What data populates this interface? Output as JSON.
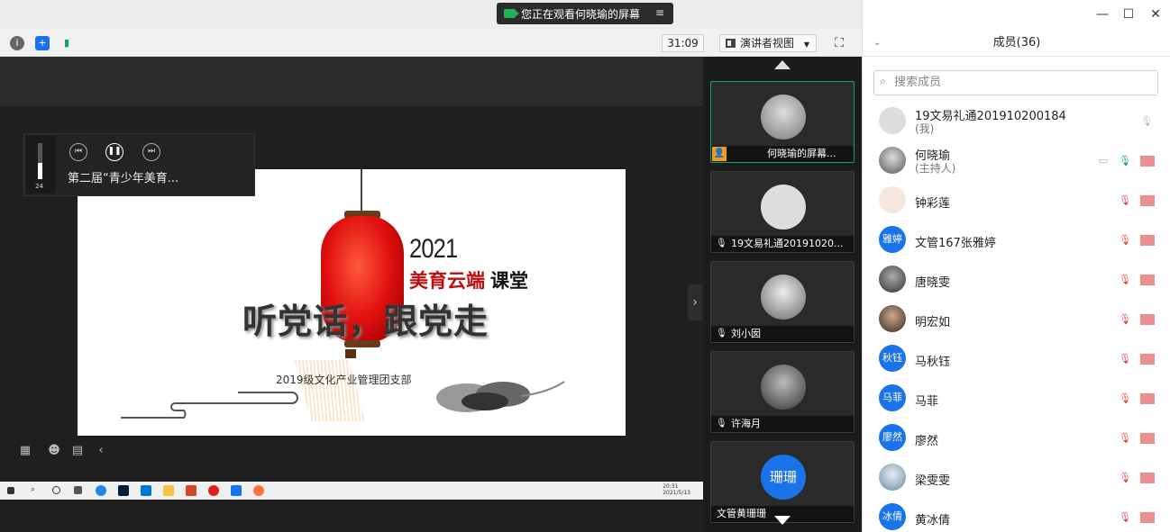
{
  "window": {
    "share_banner": "您正在观看何晓瑜的屏幕",
    "timer": "31:09",
    "view_mode": "演讲者视图"
  },
  "slide": {
    "year": "2021",
    "subtitle_red": "美育云端",
    "subtitle_black": "课堂",
    "headline": "听党话，跟党走",
    "org": "2019级文化产业管理团支部"
  },
  "player": {
    "volume_level": "24",
    "title": "第二届“青少年美育..."
  },
  "taskbar": {
    "time": "20:31",
    "date": "2021/5/13"
  },
  "tiles": [
    {
      "name": "何晓瑜的屏幕..."
    },
    {
      "name": "19文易礼通20191020..."
    },
    {
      "name": "刘小囡"
    },
    {
      "name": "许海月"
    },
    {
      "name": "文管黄珊珊",
      "avatar_text": "珊珊"
    }
  ],
  "panel": {
    "title": "成员(36)",
    "search_placeholder": "搜索成员",
    "members": [
      {
        "name": "19文易礼通201910200184",
        "role": "(我)"
      },
      {
        "name": "何晓瑜",
        "role": "(主持人)"
      },
      {
        "name": "钟彩莲"
      },
      {
        "name": "文管167张雅婷",
        "avatar_text": "雅婷"
      },
      {
        "name": "唐晓雯"
      },
      {
        "name": "明宏如"
      },
      {
        "name": "马秋钰",
        "avatar_text": "秋钰"
      },
      {
        "name": "马菲",
        "avatar_text": "马菲"
      },
      {
        "name": "廖然",
        "avatar_text": "廖然"
      },
      {
        "name": "梁雯雯"
      },
      {
        "name": "黄冰倩",
        "avatar_text": "冰倩"
      }
    ]
  },
  "colors": {
    "accent_blue": "#1a73e8",
    "active_green": "#1aa35a",
    "mute_red": "#e04444"
  }
}
